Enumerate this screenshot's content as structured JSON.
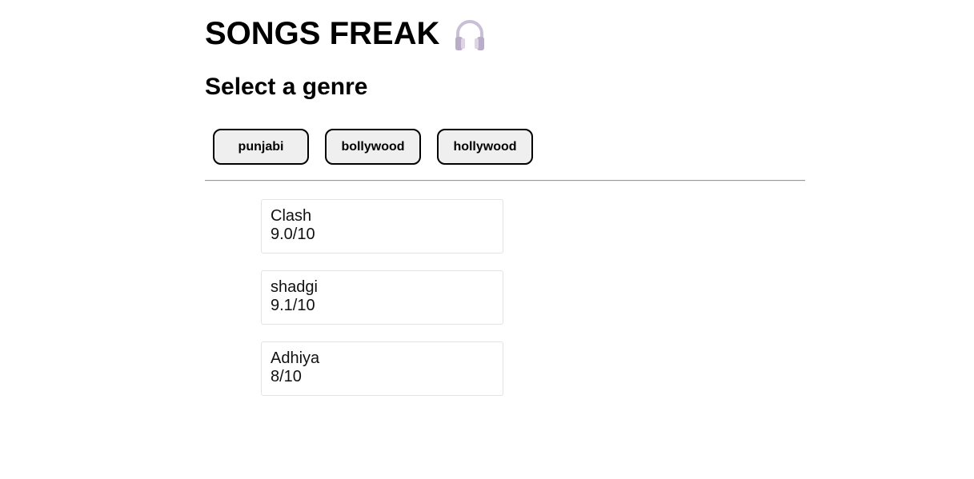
{
  "header": {
    "title": "SONGS FREAK",
    "title_icon": "headphones-icon"
  },
  "genre_section": {
    "heading": "Select a genre",
    "genres": [
      {
        "label": "punjabi"
      },
      {
        "label": "bollywood"
      },
      {
        "label": "hollywood"
      }
    ]
  },
  "songs": [
    {
      "name": "Clash",
      "rating": "9.0/10"
    },
    {
      "name": "shadgi",
      "rating": "9.1/10"
    },
    {
      "name": "Adhiya",
      "rating": "8/10"
    }
  ],
  "colors": {
    "button_bg": "#efefef",
    "button_border": "#000000",
    "card_border": "#e3e3e3",
    "headphones": "#c9bfd6"
  }
}
